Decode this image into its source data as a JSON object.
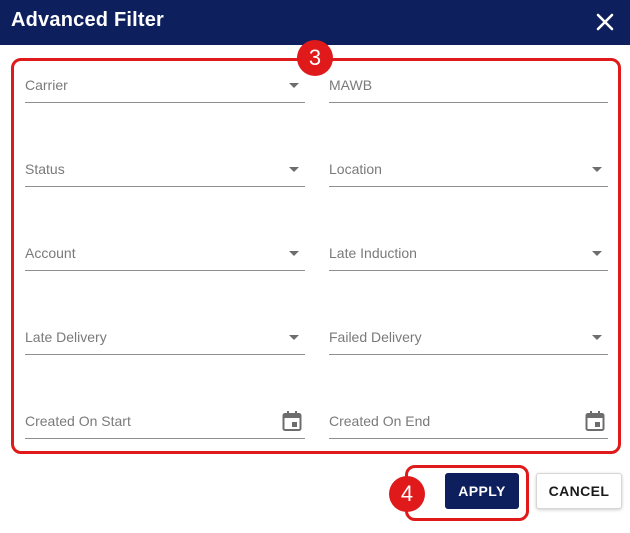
{
  "header": {
    "title": "Advanced Filter",
    "close_icon": "close-icon"
  },
  "fields": {
    "carrier": {
      "label": "Carrier",
      "icon": "chevron-down-icon"
    },
    "mawb": {
      "label": "MAWB"
    },
    "status": {
      "label": "Status",
      "icon": "chevron-down-icon"
    },
    "location": {
      "label": "Location",
      "icon": "chevron-down-icon"
    },
    "account": {
      "label": "Account",
      "icon": "chevron-down-icon"
    },
    "late_induction": {
      "label": "Late Induction",
      "icon": "chevron-down-icon"
    },
    "late_delivery": {
      "label": "Late Delivery",
      "icon": "chevron-down-icon"
    },
    "failed_delivery": {
      "label": "Failed Delivery",
      "icon": "chevron-down-icon"
    },
    "created_on_start": {
      "label": "Created On Start",
      "icon": "calendar-icon"
    },
    "created_on_end": {
      "label": "Created On End",
      "icon": "calendar-icon"
    }
  },
  "annotations": {
    "marker_fields": "3",
    "marker_apply": "4"
  },
  "actions": {
    "apply_label": "APPLY",
    "cancel_label": "CANCEL"
  },
  "colors": {
    "header_bg": "#0d1f5c",
    "highlight": "#e0191b",
    "apply_bg": "#0d1f5c"
  }
}
